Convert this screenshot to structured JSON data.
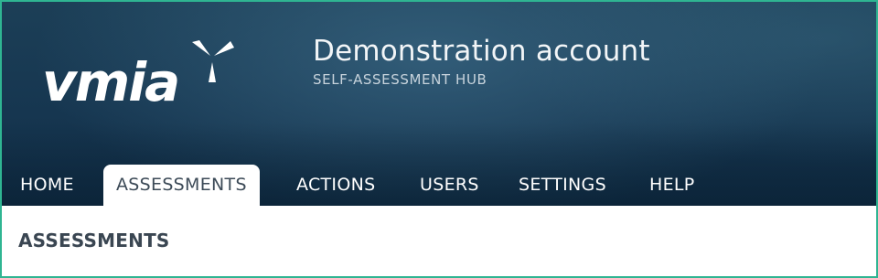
{
  "brand": {
    "logo_text": "vmia",
    "colors": {
      "banner_dark": "#163650",
      "frame_accent": "#2fb592",
      "active_tab_bg": "#ffffff",
      "text_on_dark": "#f2f5f7",
      "heading_text": "#3a4652"
    }
  },
  "header": {
    "account_name": "Demonstration account",
    "subtitle": "SELF-ASSESSMENT HUB"
  },
  "nav": {
    "tabs": [
      {
        "label": "HOME",
        "active": false
      },
      {
        "label": "ASSESSMENTS",
        "active": true
      },
      {
        "label": "ACTIONS",
        "active": false
      },
      {
        "label": "USERS",
        "active": false
      },
      {
        "label": "SETTINGS",
        "active": false
      },
      {
        "label": "HELP",
        "active": false
      }
    ]
  },
  "main": {
    "page_title": "ASSESSMENTS"
  }
}
